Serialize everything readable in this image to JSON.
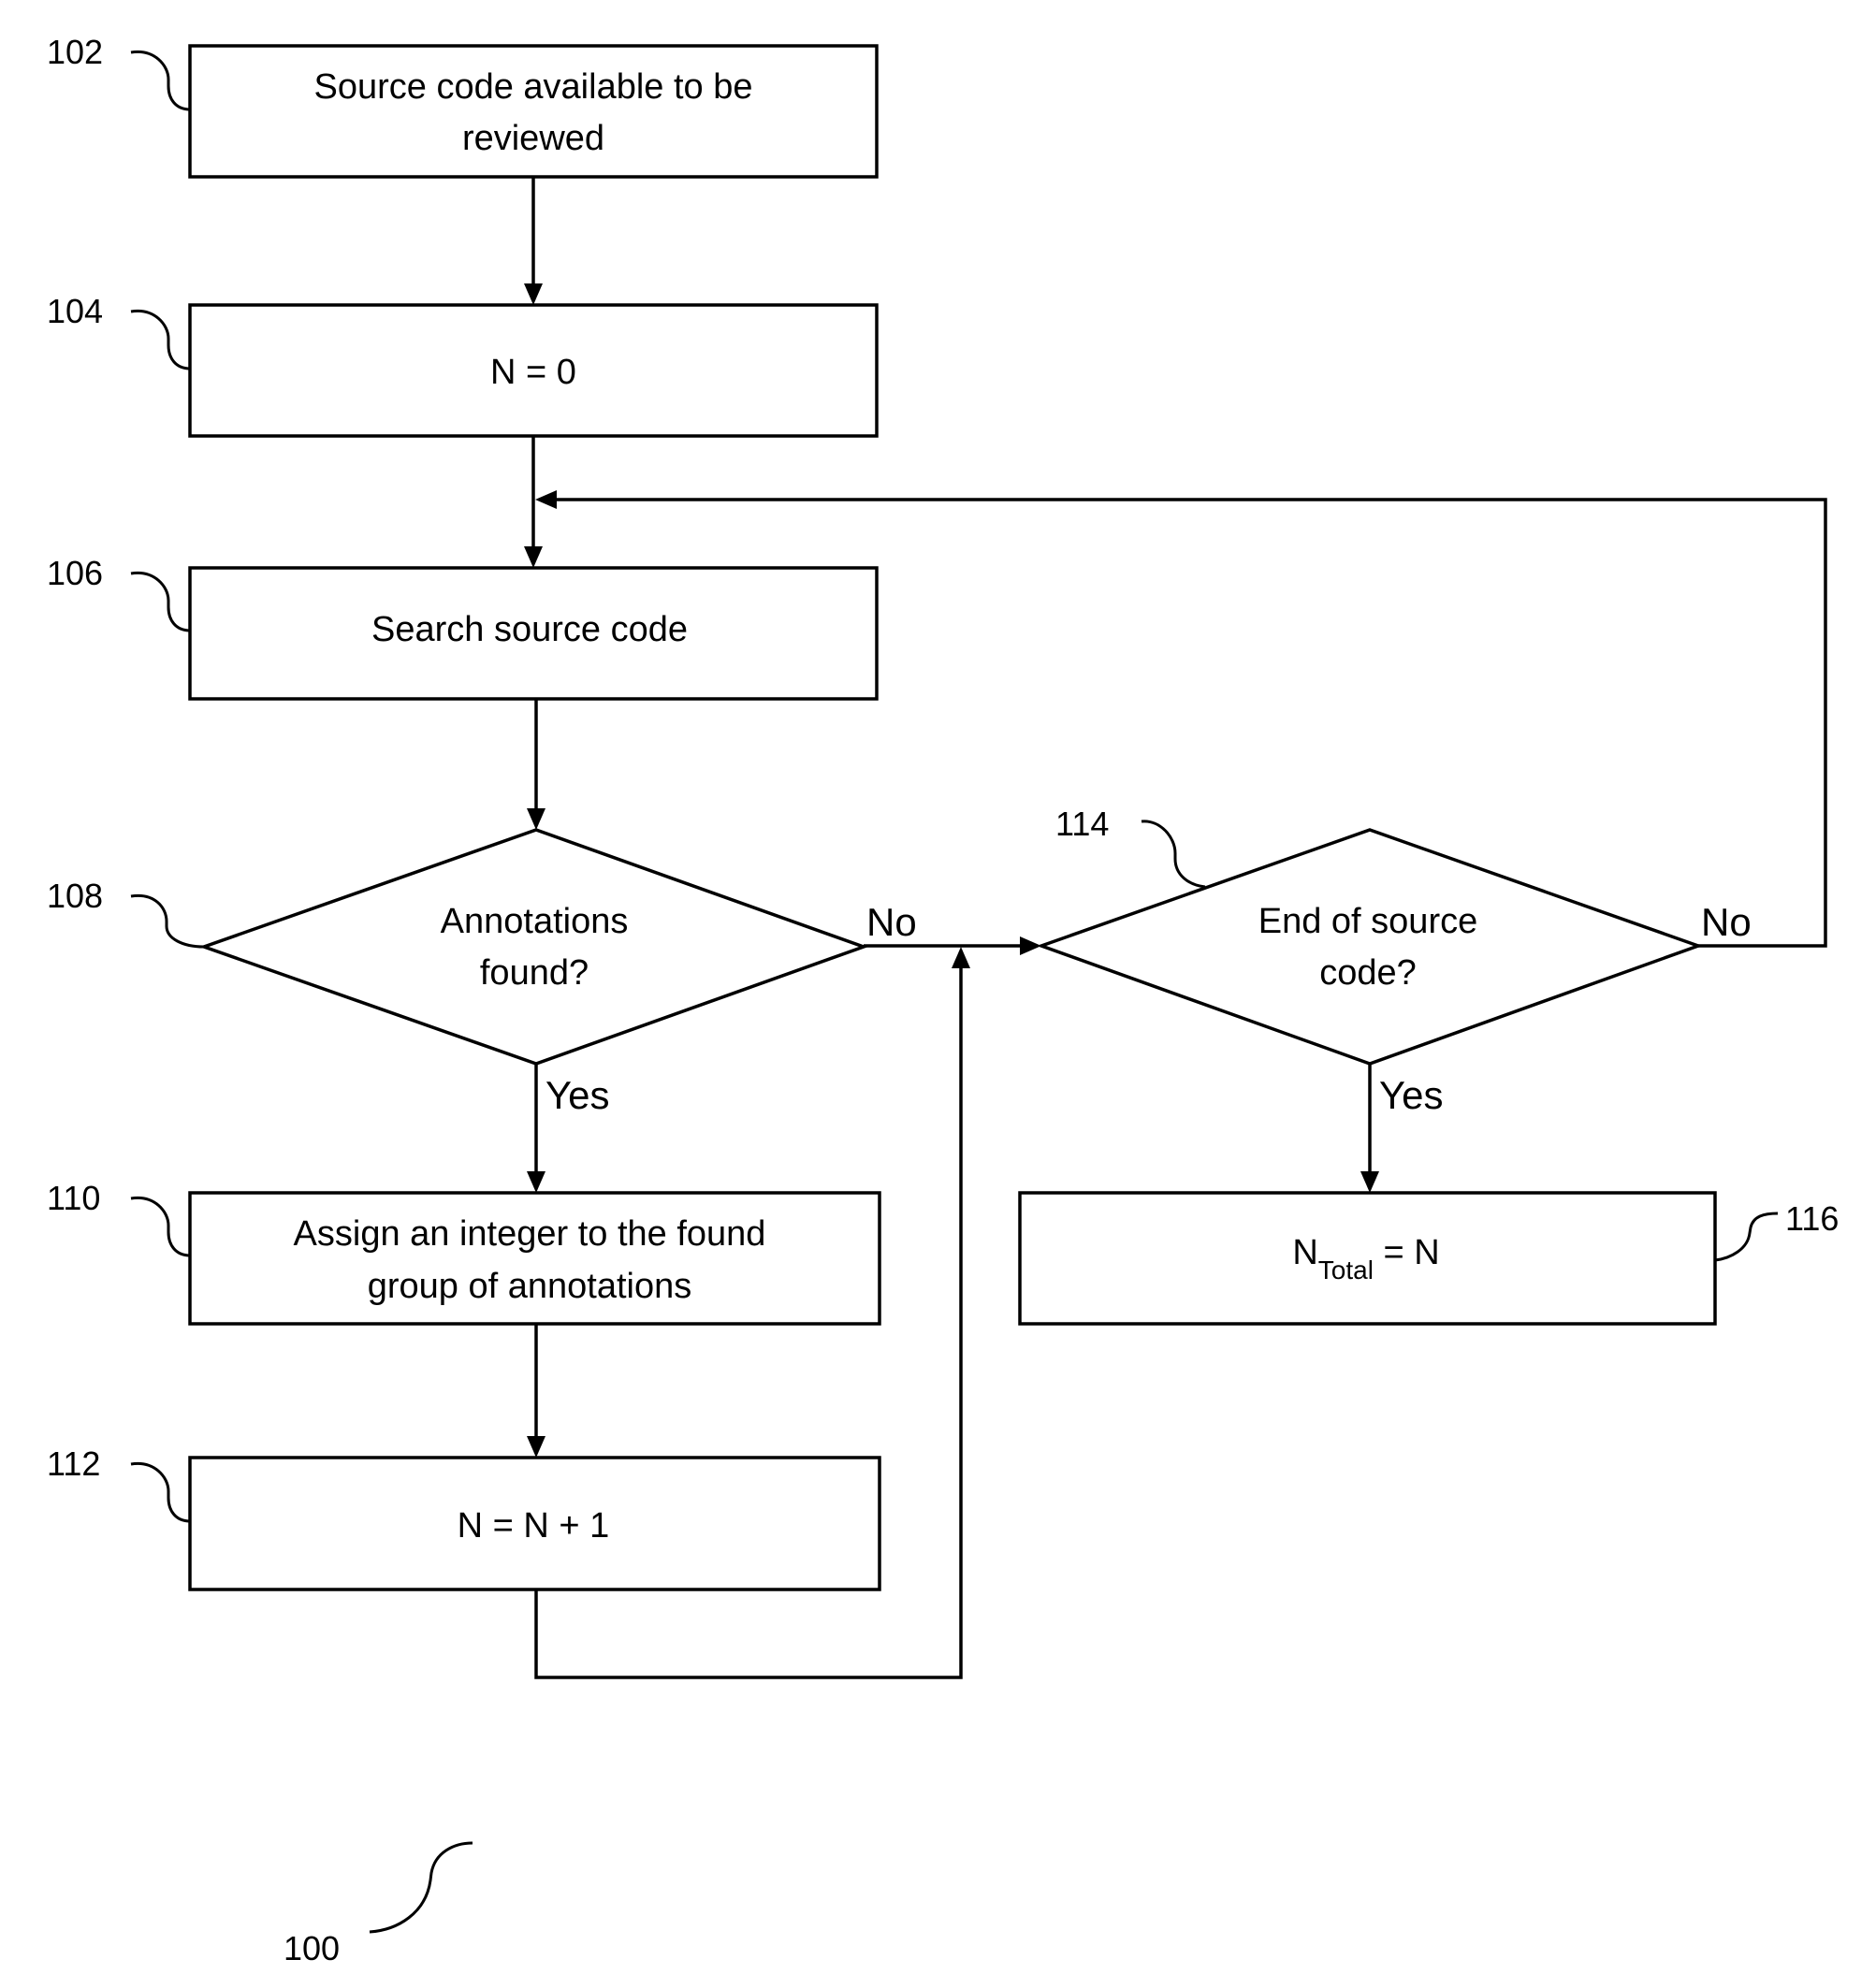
{
  "figure": {
    "reference": "100",
    "colors": {
      "line": "#000000",
      "background": "#ffffff"
    }
  },
  "nodes": {
    "n102": {
      "ref": "102",
      "shape": "process",
      "lines": [
        "Source code available to be",
        "reviewed"
      ]
    },
    "n104": {
      "ref": "104",
      "shape": "process",
      "lines": [
        "N = 0"
      ]
    },
    "n106": {
      "ref": "106",
      "shape": "process",
      "lines": [
        "Search source code"
      ]
    },
    "n108": {
      "ref": "108",
      "shape": "decision",
      "lines": [
        "Annotations",
        "found?"
      ]
    },
    "n110": {
      "ref": "110",
      "shape": "process",
      "lines": [
        "Assign an integer to the found",
        "group of annotations"
      ]
    },
    "n112": {
      "ref": "112",
      "shape": "process",
      "lines": [
        "N = N + 1"
      ]
    },
    "n114": {
      "ref": "114",
      "shape": "decision",
      "lines": [
        "End of source",
        "code?"
      ]
    },
    "n116": {
      "ref": "116",
      "shape": "process",
      "main": "N",
      "subscript": "Total",
      "rest": " = N"
    }
  },
  "edges": [
    {
      "from": "102",
      "to": "104",
      "label": ""
    },
    {
      "from": "104",
      "to": "106",
      "label": ""
    },
    {
      "from": "106",
      "to": "108",
      "label": ""
    },
    {
      "from": "108",
      "to": "110",
      "label": "Yes"
    },
    {
      "from": "108",
      "to": "114",
      "label": "No"
    },
    {
      "from": "110",
      "to": "112",
      "label": ""
    },
    {
      "from": "112",
      "to": "114",
      "label": ""
    },
    {
      "from": "114",
      "to": "106",
      "label": "No"
    },
    {
      "from": "114",
      "to": "116",
      "label": "Yes"
    }
  ],
  "labels": {
    "yes": "Yes",
    "no": "No"
  }
}
